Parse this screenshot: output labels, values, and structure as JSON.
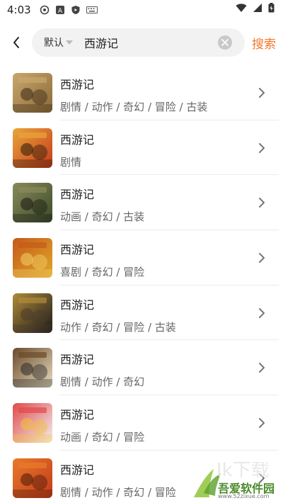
{
  "status_bar": {
    "time": "4:03",
    "left_icons": [
      "sync-icon",
      "a-icon",
      "shield-icon",
      "keyboard-icon"
    ],
    "right_icons": [
      "wifi-icon",
      "signal-icon",
      "battery-icon"
    ]
  },
  "header": {
    "filter_label": "默认",
    "search_value": "西游记",
    "search_button": "搜索"
  },
  "results": [
    {
      "title": "西游记",
      "tags": "剧情 / 动作 / 奇幻 / 冒险 / 古装",
      "thumb_colors": [
        "#8a6a3a",
        "#c9a66b",
        "#3a2a18"
      ]
    },
    {
      "title": "西游记",
      "tags": "剧情",
      "thumb_colors": [
        "#c43a1c",
        "#e9a53a",
        "#2a1a0a"
      ]
    },
    {
      "title": "西游记",
      "tags": "动画 / 奇幻 / 古装",
      "thumb_colors": [
        "#3a4a2a",
        "#8a8a5a",
        "#1a1a12"
      ]
    },
    {
      "title": "西游记",
      "tags": "喜剧 / 奇幻 / 冒险",
      "thumb_colors": [
        "#e0a62a",
        "#c45a1a",
        "#f3d06a"
      ]
    },
    {
      "title": "西游记",
      "tags": "动作 / 奇幻 / 冒险 / 古装",
      "thumb_colors": [
        "#1a1a1a",
        "#b08a3a",
        "#4a3a2a"
      ]
    },
    {
      "title": "西游记",
      "tags": "剧情 / 动作 / 奇幻",
      "thumb_colors": [
        "#e8dcc0",
        "#6a4a2a",
        "#2a2a2a"
      ]
    },
    {
      "title": "西游记",
      "tags": "动画 / 奇幻 / 冒险",
      "thumb_colors": [
        "#f2f2f2",
        "#e04a4a",
        "#f3c03a"
      ]
    },
    {
      "title": "西游记",
      "tags": "剧情 / 动作 / 奇幻 / 冒险",
      "thumb_colors": [
        "#c23a1a",
        "#e87a2a",
        "#4a1a0a"
      ]
    }
  ],
  "watermark": {
    "brand": "吾爱软件园",
    "url": "www.52zixue.com"
  },
  "colors": {
    "accent": "#f3782b",
    "search_bg": "#f2f2f2",
    "divider": "#ececec"
  }
}
